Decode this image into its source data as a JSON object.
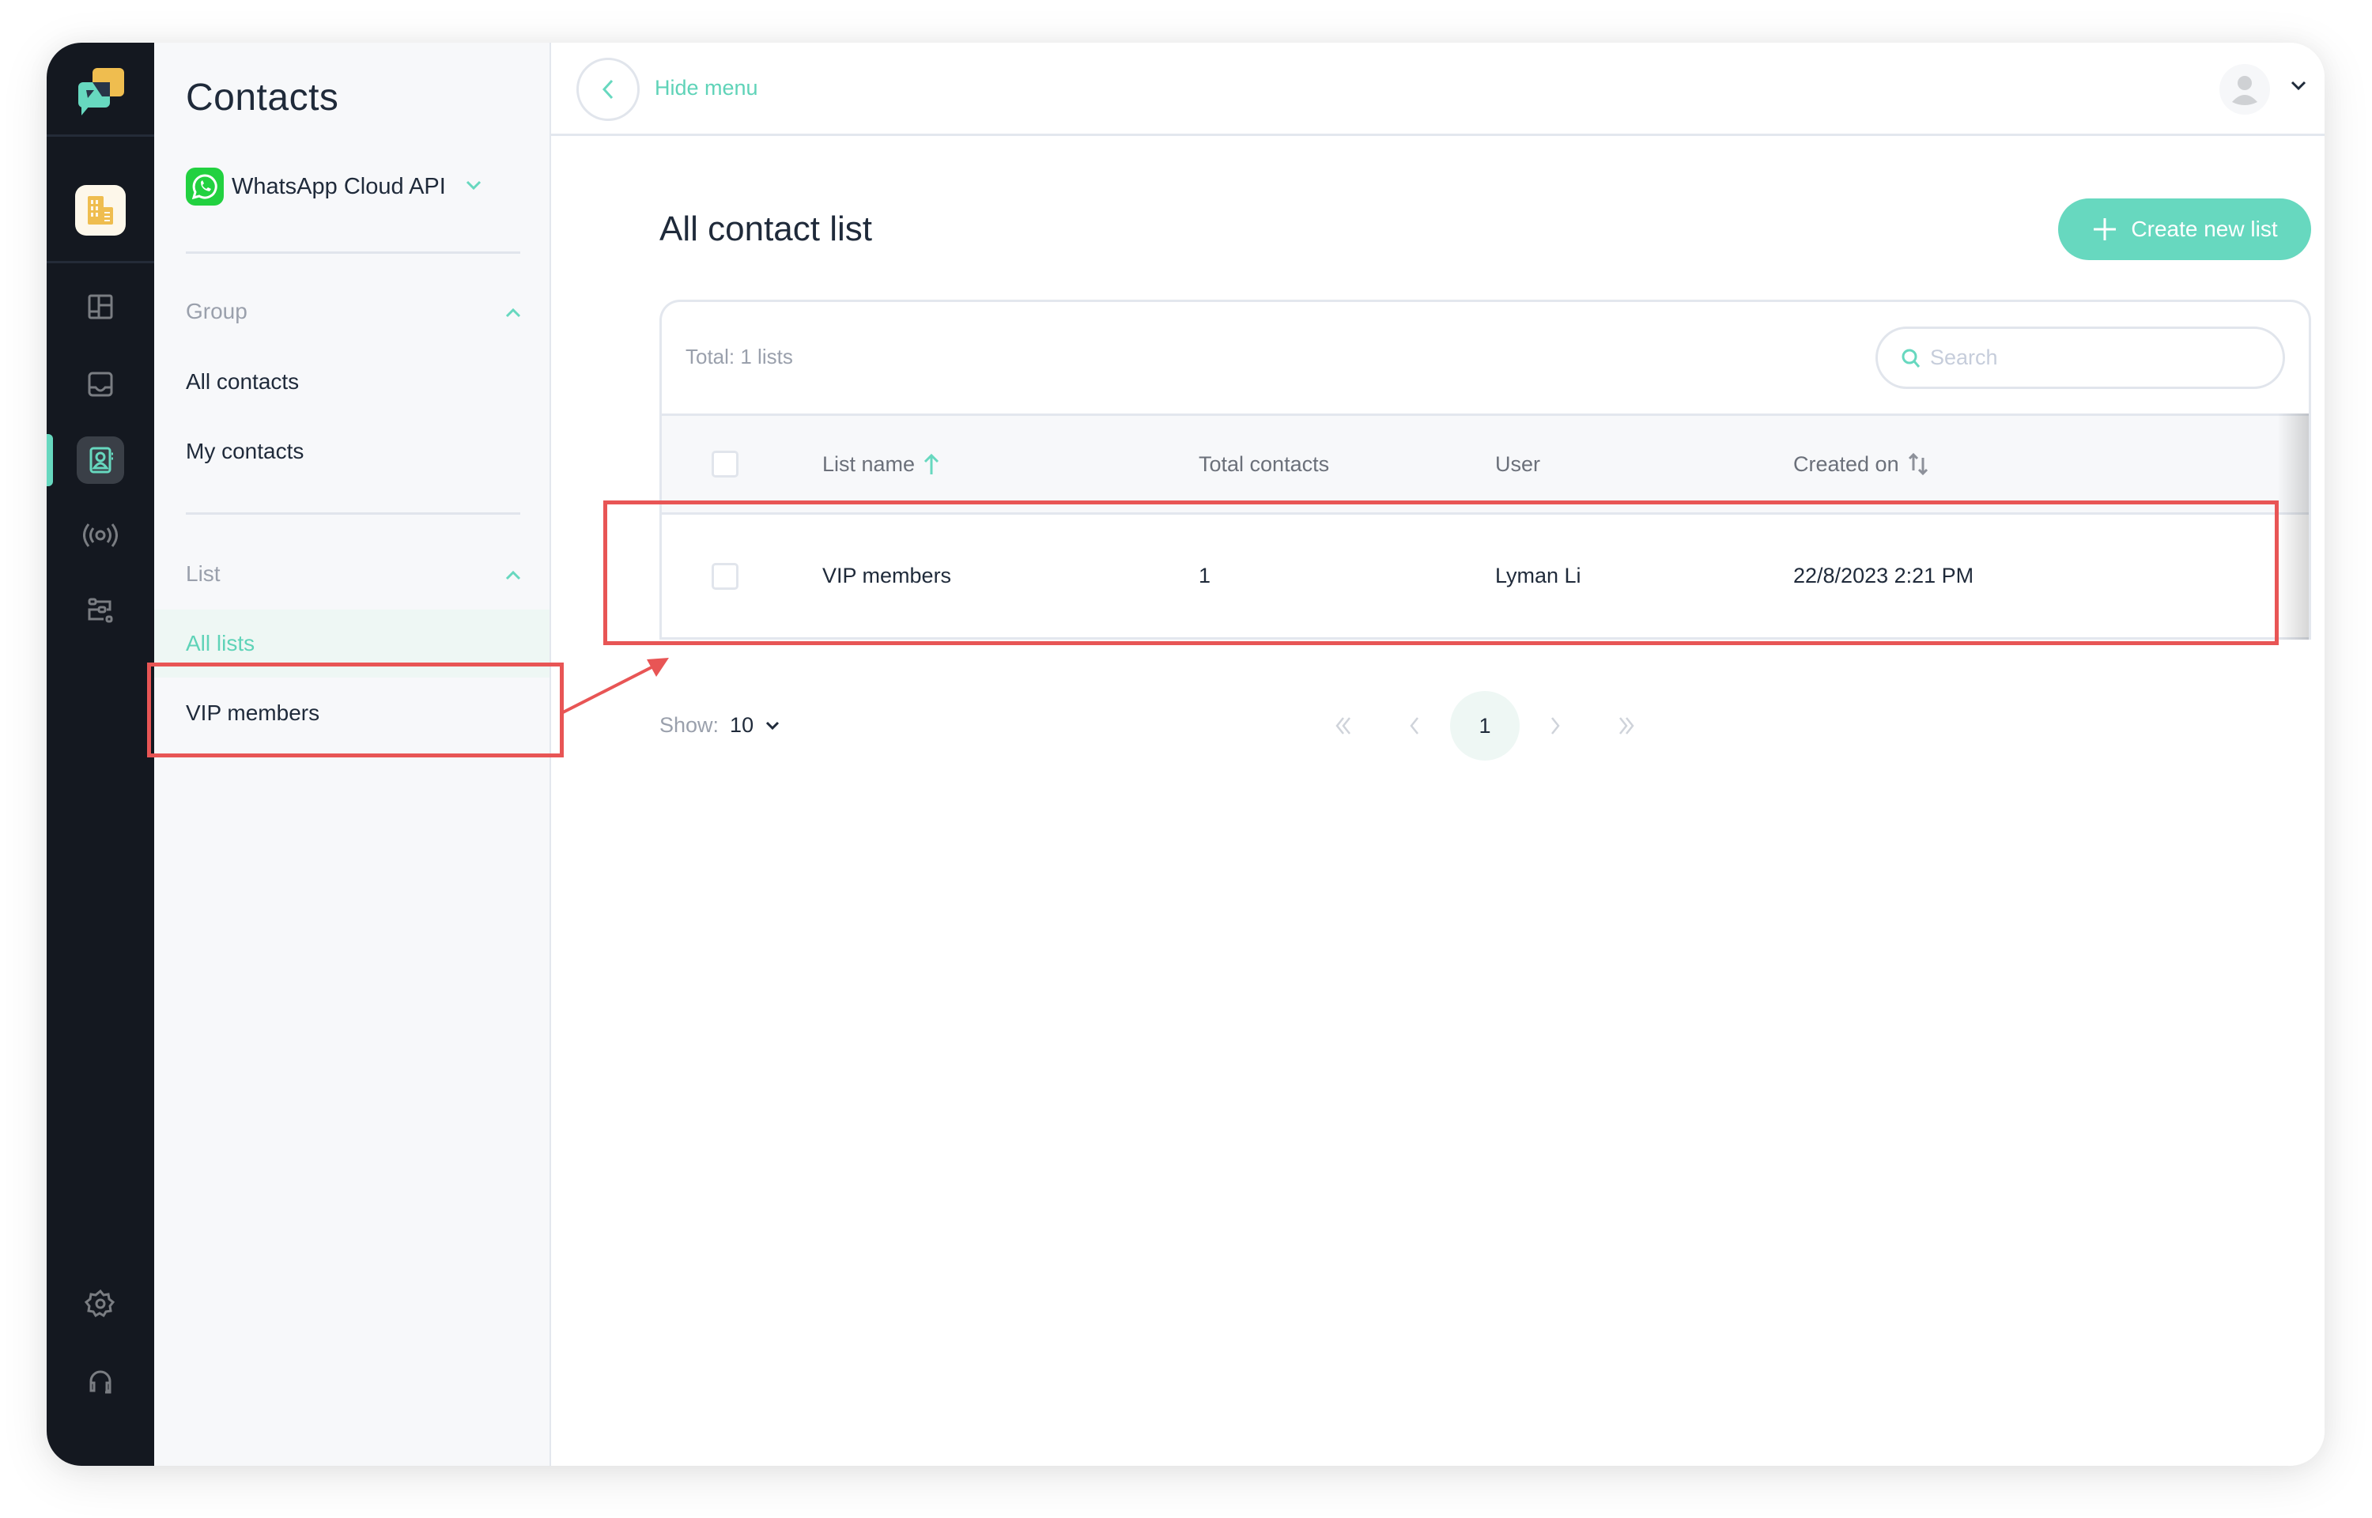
{
  "rail": {
    "icons": [
      "app-logo",
      "organization",
      "dashboard",
      "inbox",
      "contacts",
      "broadcast",
      "workflow",
      "settings",
      "support"
    ],
    "active": "contacts",
    "accent": "#67d8bf"
  },
  "side": {
    "title": "Contacts",
    "channel": {
      "name": "WhatsApp Cloud API"
    },
    "group": {
      "label": "Group",
      "items": [
        "All contacts",
        "My contacts"
      ]
    },
    "list": {
      "label": "List",
      "items": [
        "All lists",
        "VIP members"
      ],
      "active_index": 0
    }
  },
  "topbar": {
    "hide_menu": "Hide menu"
  },
  "main": {
    "title": "All contact list",
    "create_button": "Create new list",
    "total": "Total: 1 lists",
    "search_placeholder": "Search",
    "columns": [
      "List name",
      "Total contacts",
      "User",
      "Created on"
    ],
    "rows": [
      {
        "list_name": "VIP members",
        "total_contacts": "1",
        "user": "Lyman Li",
        "created_on": "22/8/2023 2:21 PM"
      }
    ],
    "pagination": {
      "show_label": "Show:",
      "page_size": "10",
      "current_page": "1"
    }
  },
  "colors": {
    "accent": "#67d8bf",
    "annotation": "#e85555",
    "rail_bg": "#141820",
    "whatsapp": "#22d140"
  }
}
